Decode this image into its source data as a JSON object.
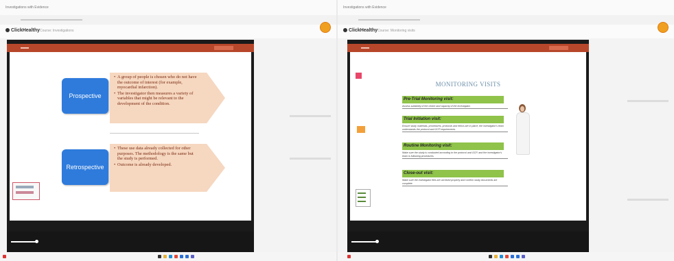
{
  "left": {
    "browser_title": "Investigations with Evidence",
    "app": {
      "name": "ClickHealthy",
      "caption": "Course: Investigations"
    },
    "slide": {
      "items": [
        {
          "label": "Prospective",
          "bullets": [
            "A group of people is chosen who do not have the outcome of interest (for example, myocardial infarction).",
            "The investigator then measures a variety of variables that might be relevant to the development of the condition."
          ]
        },
        {
          "label": "Retrospective",
          "bullets": [
            "These use data already collected for other purposes. The methodology is the same but the study is performed.",
            "Outcome is already developed."
          ]
        }
      ]
    }
  },
  "right": {
    "browser_title": "Investigations with Evidence",
    "app": {
      "name": "ClickHealthy",
      "caption": "Course: Monitoring visits"
    },
    "slide": {
      "title": "MONITORING VISITS",
      "visits": [
        {
          "heading": "Pre-Trial Monitoring visit:",
          "desc": "Assess suitability of the centre and capacity of the investigator."
        },
        {
          "heading": "Trial Initiation visit:",
          "desc": "Ensure study materials, procedures, protocols and ethics are in place; the investigator's team understands the protocol and GCP requirements."
        },
        {
          "heading": "Routine Monitoring visit:",
          "desc": "Make sure the study is conducted according to the protocol and GCP, and the investigator's team is following procedures."
        },
        {
          "heading": "Close-out visit:",
          "desc": "Make sure the investigator files are archived properly and confirm study documents are complete."
        }
      ]
    }
  },
  "taskbar_icons": [
    {
      "name": "windows",
      "color": "#2a6fd6"
    },
    {
      "name": "search",
      "color": "#333333"
    },
    {
      "name": "explorer",
      "color": "#e8b33a"
    },
    {
      "name": "edge",
      "color": "#1f8fd8"
    },
    {
      "name": "chrome",
      "color": "#e34a3a"
    },
    {
      "name": "mail",
      "color": "#2a6fd6"
    },
    {
      "name": "store",
      "color": "#2a6fd6"
    },
    {
      "name": "teams",
      "color": "#5b5fc7"
    }
  ]
}
